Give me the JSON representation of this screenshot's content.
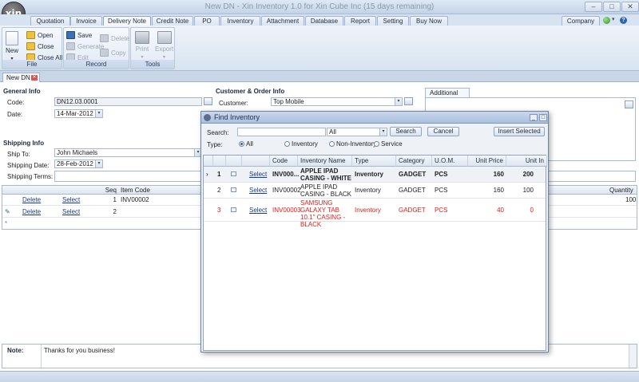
{
  "window": {
    "title": "New DN - Xin Inventory 1.0 for Xin Cube Inc (15 days remaining)",
    "logo": "xin"
  },
  "tabs": [
    "Quotation",
    "Invoice",
    "Delivery Note",
    "Credit Note",
    "PO",
    "Inventory",
    "Attachment",
    "Database",
    "Report",
    "Setting",
    "Buy Now"
  ],
  "active_tab": "Delivery Note",
  "company_label": "Company",
  "ribbon": {
    "file": {
      "label": "File",
      "new": "New",
      "open": "Open",
      "close": "Close",
      "close_all": "Close All"
    },
    "record": {
      "label": "Record",
      "save": "Save",
      "generate": "Generate",
      "edit": "Edit",
      "delete": "Delete",
      "copy": "Copy"
    },
    "tools": {
      "label": "Tools",
      "print": "Print",
      "export": "Export"
    }
  },
  "doc_tab": "New DN",
  "general": {
    "title": "General Info",
    "code_label": "Code:",
    "code": "DN12.03.0001",
    "date_label": "Date:",
    "date": "14-Mar-2012"
  },
  "customer": {
    "title": "Customer & Order Info",
    "customer_label": "Customer:",
    "customer": "Top Mobile"
  },
  "additional_tab": "Additional Info",
  "shipping": {
    "title": "Shipping Info",
    "ship_to_label": "Ship To:",
    "ship_to": "John Michaels",
    "date_label": "Shipping Date:",
    "date": "28-Feb-2012",
    "terms_label": "Shipping Terms:",
    "terms": ""
  },
  "items_grid": {
    "headers": {
      "seq": "Seq",
      "item_code": "Item Code",
      "quantity": "Quantity"
    },
    "rows": [
      {
        "delete": "Delete",
        "select": "Select",
        "seq": "1",
        "item_code": "INV00002",
        "quantity": "100"
      },
      {
        "delete": "Delete",
        "select": "Select",
        "seq": "2",
        "item_code": "",
        "quantity": ""
      }
    ]
  },
  "note": {
    "label": "Note:",
    "value": "Thanks for you business!"
  },
  "dialog": {
    "title": "Find Inventory",
    "search_label": "Search:",
    "search_value": "",
    "filter_value": "All",
    "search_button": "Search",
    "cancel_button": "Cancel",
    "insert_button": "Insert Selected",
    "type_label": "Type:",
    "types": [
      "All",
      "Inventory",
      "Non-Inventory",
      "Service"
    ],
    "selected_type": "All",
    "columns": [
      "Code",
      "Inventory Name",
      "Type",
      "Category",
      "U.O.M.",
      "Unit Price",
      "Unit In Stock"
    ],
    "rows": [
      {
        "num": "1",
        "select": "Select",
        "code": "INV000...",
        "name": "APPLE IPAD CASING - WHITE",
        "type": "Inventory",
        "category": "GADGET",
        "uom": "PCS",
        "price": "160",
        "stock": "200",
        "style": "bold"
      },
      {
        "num": "2",
        "select": "Select",
        "code": "INV00002",
        "name": "APPLE IPAD CASING - BLACK",
        "type": "Inventory",
        "category": "GADGET",
        "uom": "PCS",
        "price": "160",
        "stock": "100",
        "style": "normal"
      },
      {
        "num": "3",
        "select": "Select",
        "code": "INV00003",
        "name": "SAMSUNG GALAXY TAB 10.1\" CASING - BLACK",
        "type": "Inventory",
        "category": "GADGET",
        "uom": "PCS",
        "price": "40",
        "stock": "0",
        "style": "red"
      }
    ]
  },
  "colors": {
    "accent": "#2e5ba8",
    "alert_red": "#e0201b",
    "link": "#1a3b8c"
  }
}
